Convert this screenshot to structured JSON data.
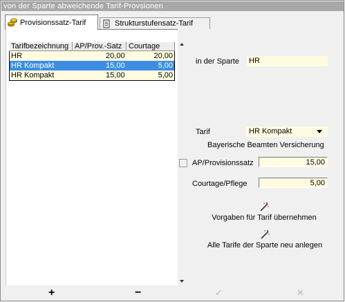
{
  "window": {
    "title": "von der Sparte abweichende Tarif-Provsionen"
  },
  "tabs": [
    {
      "label": "Provisionssatz-Tarif",
      "icon": "coins-icon",
      "active": true
    },
    {
      "label": "Strukturstufensatz-Tarif",
      "icon": "list-icon",
      "active": false
    }
  ],
  "table": {
    "columns": [
      "Tarifbezeichnung",
      "AP/Prov.-Satz",
      "Courtage"
    ],
    "rows": [
      {
        "name": "HR",
        "ap": "20,00",
        "courtage": "20,00",
        "selected": false
      },
      {
        "name": "HR Kompakt",
        "ap": "15,00",
        "courtage": "5,00",
        "selected": true
      },
      {
        "name": "HR Kompakt",
        "ap": "15,00",
        "courtage": "5,00",
        "selected": false
      }
    ]
  },
  "detail": {
    "sparte_label": "in der Sparte",
    "sparte_value": "HR",
    "tarif_label": "Tarif",
    "tarif_value": "HR Kompakt",
    "company": "Bayerische Beamten Versicherung",
    "ap_label": "AP/Provisionssatz",
    "ap_value": "15,00",
    "courtage_label": "Courtage/Pflege",
    "courtage_value": "5,00"
  },
  "actions": {
    "apply_defaults": "Vorgaben für Tarif übernehmen",
    "create_all": "Alle Tarife der Sparte neu anlegen"
  },
  "toolbar": {
    "add": "+",
    "remove": "−",
    "confirm": "✓",
    "cancel": "✕"
  },
  "colors": {
    "selection": "#3d8ee2",
    "field_background": "#fffbe0",
    "titlebar": "#a7a7a7"
  }
}
